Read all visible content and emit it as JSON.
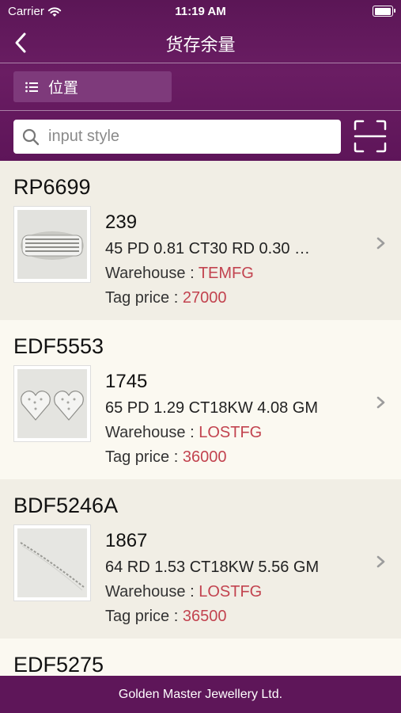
{
  "status": {
    "carrier": "Carrier",
    "time": "11:19 AM"
  },
  "nav": {
    "title": "货存余量"
  },
  "location_button": {
    "label": "位置"
  },
  "search": {
    "placeholder": "input style",
    "value": ""
  },
  "items": [
    {
      "code": "RP6699",
      "qty": "239",
      "desc": "45 PD 0.81 CT30 RD 0.30 …",
      "warehouse_label": "Warehouse : ",
      "warehouse": "TEMFG",
      "price_label": "Tag price : ",
      "price": "27000",
      "image": "ring"
    },
    {
      "code": "EDF5553",
      "qty": "1745",
      "desc": "65 PD 1.29 CT18KW 4.08 GM",
      "warehouse_label": "Warehouse : ",
      "warehouse": "LOSTFG",
      "price_label": "Tag price : ",
      "price": "36000",
      "image": "heart-earrings"
    },
    {
      "code": "BDF5246A",
      "qty": "1867",
      "desc": "64 RD 1.53 CT18KW 5.56 GM",
      "warehouse_label": "Warehouse : ",
      "warehouse": "LOSTFG",
      "price_label": "Tag price : ",
      "price": "36500",
      "image": "bracelet"
    },
    {
      "code": "EDF5275"
    }
  ],
  "footer": {
    "text": "Golden Master Jewellery Ltd."
  },
  "colors": {
    "header": "#5e1659",
    "accent_red": "#c2434f",
    "list_bg": "#f6f4ee"
  }
}
